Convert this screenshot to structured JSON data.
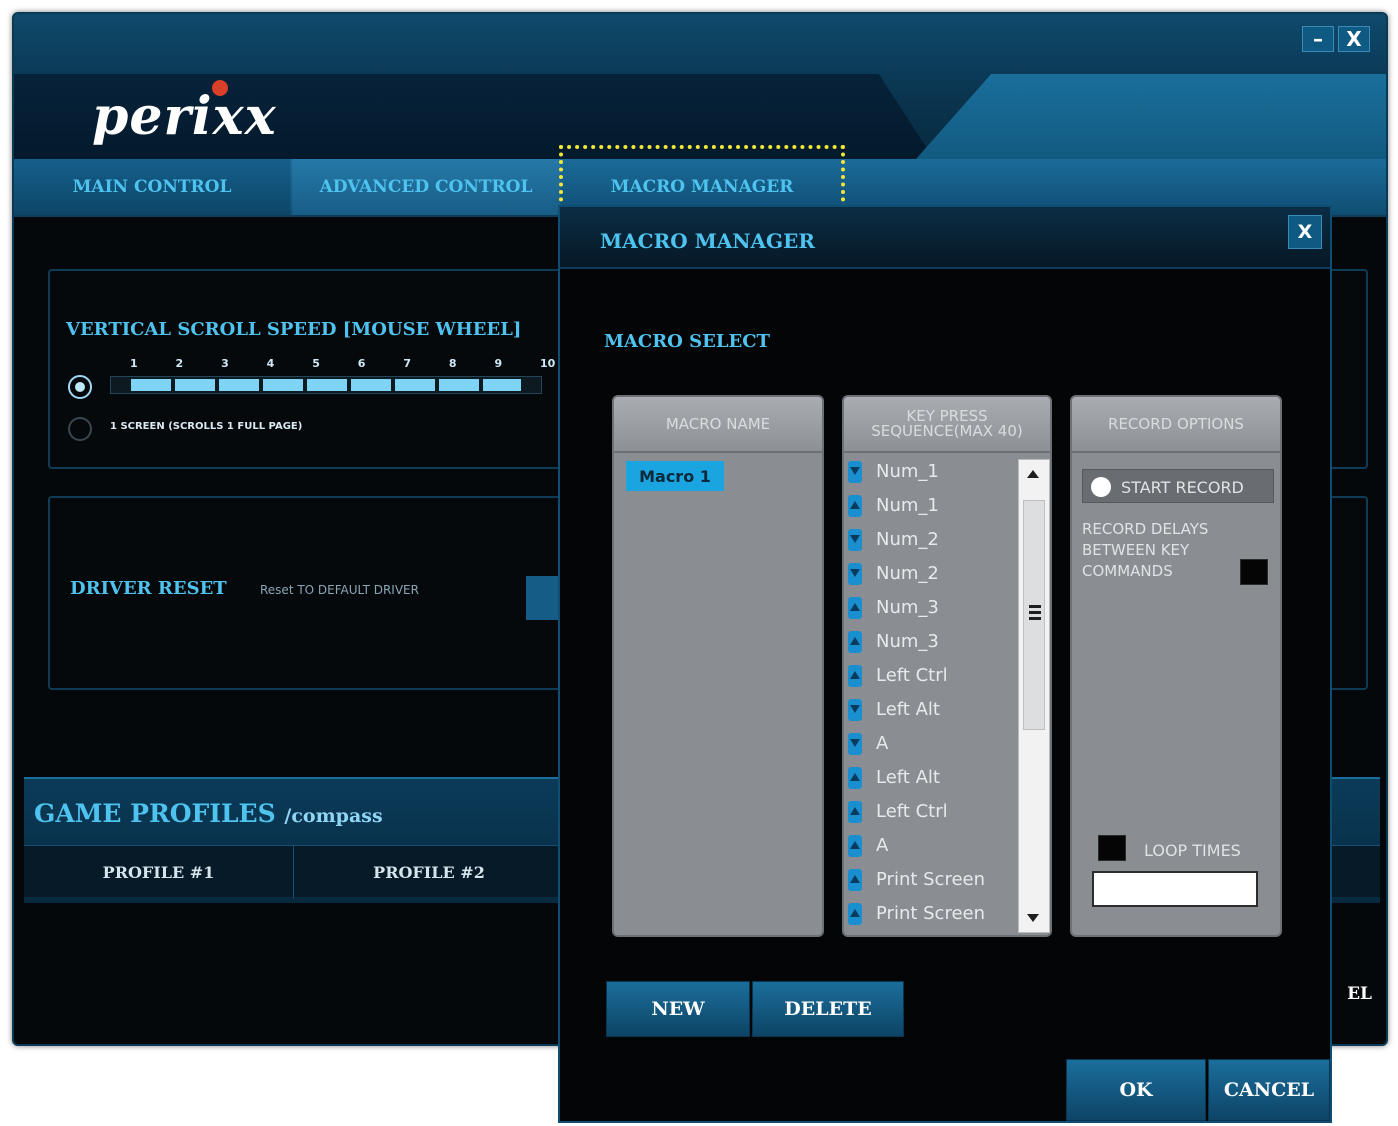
{
  "window": {
    "logo": "perixx",
    "minimize": "–",
    "close": "X"
  },
  "tabs": {
    "main": "MAIN CONTROL",
    "advanced": "ADVANCED CONTROL",
    "macro": "MACRO MANAGER"
  },
  "scroll": {
    "title": "VERTICAL SCROLL SPEED [MOUSE WHEEL]",
    "ticks": [
      "1",
      "2",
      "3",
      "4",
      "5",
      "6",
      "7",
      "8",
      "9",
      "10"
    ],
    "level_fraction": 0.95,
    "option2": "1 SCREEN (SCROLLS 1 FULL PAGE)"
  },
  "reset": {
    "label": "DRIVER RESET",
    "value": "Reset TO DEFAULT DRIVER"
  },
  "profiles": {
    "title": "GAME PROFILES",
    "subtitle": "/compass",
    "items": [
      "PROFILE #1",
      "PROFILE #2"
    ]
  },
  "background": {
    "cancel_partial": "EL"
  },
  "dialog": {
    "title": "MACRO MANAGER",
    "close": "X",
    "macro_select": "MACRO SELECT",
    "col_name_header": "MACRO NAME",
    "col_keys_header": "KEY PRESS SEQUENCE(MAX 40)",
    "col_opts_header": "RECORD OPTIONS",
    "macros": [
      "Macro 1"
    ],
    "keys": [
      {
        "label": "Num_1",
        "dir": "down"
      },
      {
        "label": "Num_1",
        "dir": "up"
      },
      {
        "label": "Num_2",
        "dir": "down"
      },
      {
        "label": "Num_2",
        "dir": "down"
      },
      {
        "label": "Num_3",
        "dir": "up"
      },
      {
        "label": "Num_3",
        "dir": "up"
      },
      {
        "label": "Left Ctrl",
        "dir": "up"
      },
      {
        "label": "Left Alt",
        "dir": "down"
      },
      {
        "label": "A",
        "dir": "down"
      },
      {
        "label": "Left Alt",
        "dir": "up"
      },
      {
        "label": "Left Ctrl",
        "dir": "up"
      },
      {
        "label": "A",
        "dir": "up"
      },
      {
        "label": "Print Screen",
        "dir": "up"
      },
      {
        "label": "Print Screen",
        "dir": "up"
      }
    ],
    "start_record": "START RECORD",
    "record_delays": "RECORD DELAYS BETWEEN KEY COMMANDS",
    "loop_times": "LOOP TIMES",
    "loop_value": "",
    "new": "NEW",
    "delete": "DELETE",
    "ok": "OK",
    "cancel": "CANCEL"
  }
}
